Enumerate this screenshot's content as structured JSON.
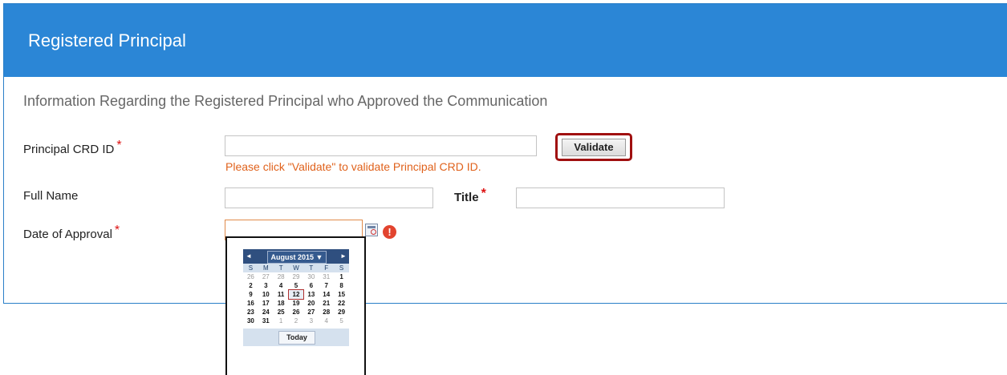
{
  "header": {
    "title": "Registered Principal"
  },
  "section": {
    "subtitle": "Information Regarding the Registered Principal who Approved the Communication"
  },
  "form": {
    "crd_label": "Principal CRD ID",
    "crd_value": "",
    "crd_hint": "Please click \"Validate\" to validate Principal CRD ID.",
    "validate_label": "Validate",
    "full_name_label": "Full Name",
    "full_name_value": "",
    "title_label": "Title",
    "title_value": "",
    "date_label": "Date of Approval",
    "date_value": "",
    "required_marker": "*",
    "error_glyph": "!"
  },
  "calendar": {
    "prev_glyph": "◄",
    "next_glyph": "►",
    "month_label": "August 2015 ▼",
    "days_of_week": [
      "S",
      "M",
      "T",
      "W",
      "T",
      "F",
      "S"
    ],
    "weeks": [
      [
        "26",
        "27",
        "28",
        "29",
        "30",
        "31",
        "1"
      ],
      [
        "2",
        "3",
        "4",
        "5",
        "6",
        "7",
        "8"
      ],
      [
        "9",
        "10",
        "11",
        "12",
        "13",
        "14",
        "15"
      ],
      [
        "16",
        "17",
        "18",
        "19",
        "20",
        "21",
        "22"
      ],
      [
        "23",
        "24",
        "25",
        "26",
        "27",
        "28",
        "29"
      ],
      [
        "30",
        "31",
        "1",
        "2",
        "3",
        "4",
        "5"
      ]
    ],
    "selected_day": "12",
    "today_label": "Today"
  },
  "colors": {
    "header_bg": "#2b86d6",
    "hint": "#e0621c",
    "required": "#dd1111",
    "calendar_header": "#2f4f7f"
  }
}
